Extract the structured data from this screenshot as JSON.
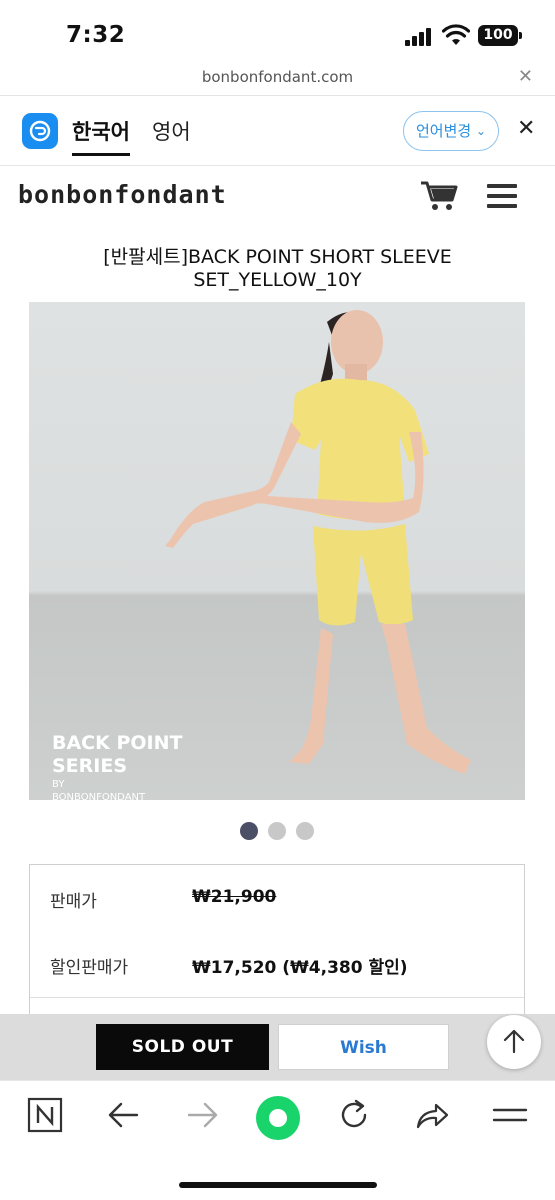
{
  "status_bar": {
    "time": "7:32",
    "battery": "100"
  },
  "url_bar": {
    "url": "bonbonfondant.com",
    "close_icon": "close-icon"
  },
  "translate_bar": {
    "lang_source": "한국어",
    "lang_target": "영어",
    "change_label": "언어변경",
    "close_icon": "close-icon"
  },
  "site_header": {
    "brand": "bonbonfondant"
  },
  "product": {
    "title": "[반팔세트]BACK POINT SHORT SLEEVE SET_YELLOW_10Y",
    "image_caption_line1": "BACK POINT",
    "image_caption_line2": "SERIES",
    "image_caption_line3": "BY",
    "image_caption_line4": "BONBONFONDANT",
    "carousel": {
      "total": 3,
      "active": 1
    }
  },
  "prices": {
    "list_label": "판매가",
    "list_value": "₩21,900",
    "sale_label": "할인판매가",
    "sale_value": "₩17,520 (₩4,380 할인)"
  },
  "actions": {
    "soldout_label": "SOLD OUT",
    "wish_label": "Wish"
  },
  "colors": {
    "accent": "#1a8ef0",
    "wish_text": "#2a7ad0",
    "green_button": "#19d36b",
    "soldout_bg": "#0a0a0a"
  }
}
